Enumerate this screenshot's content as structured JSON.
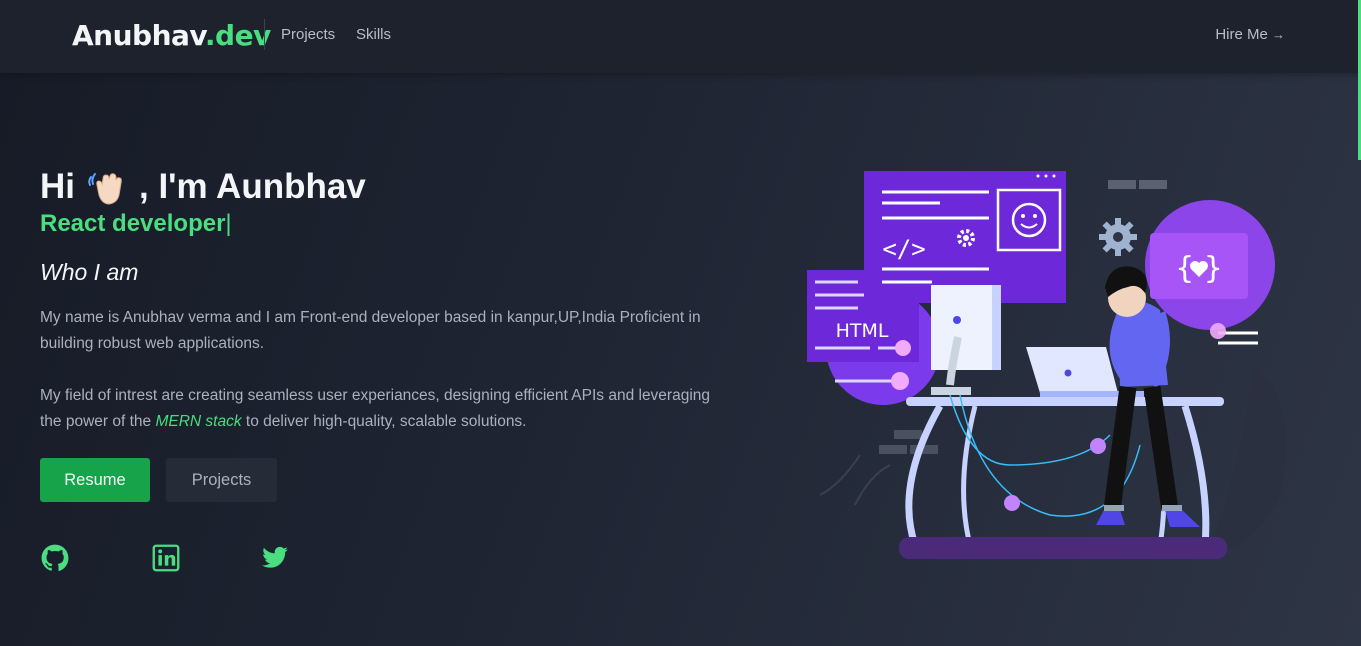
{
  "nav": {
    "brand_name": "Anubhav",
    "brand_suffix": ".dev",
    "links": [
      "Projects",
      "Skills"
    ],
    "hire_label": "Hire Me",
    "hire_icon": "arrow-right-icon"
  },
  "hero": {
    "greeting_prefix": "Hi",
    "greeting_suffix": ", I'm Aunbhav",
    "wave_icon": "waving-hand-icon",
    "role": "React developer",
    "cursor": "|",
    "who_title": "Who I am",
    "bio_1": "My name is Anubhav verma and I am Front-end developer based in kanpur,UP,India Proficient in building robust web applications.",
    "bio_2_before": "My field of intrest are creating seamless user experiances, designing efficient APIs and leveraging the power of the ",
    "bio_2_highlight": "MERN stack",
    "bio_2_after": " to deliver high-quality, scalable solutions.",
    "buttons": {
      "resume": "Resume",
      "projects": "Projects"
    },
    "socials": [
      "github-icon",
      "linkedin-icon",
      "twitter-icon"
    ],
    "illustration": {
      "html_label": "HTML",
      "code_tag": "</>",
      "braces_tag": "{ }"
    }
  },
  "colors": {
    "accent_green": "#4ade80",
    "button_green": "#16a34a",
    "illustration_purple": "#7c3aed",
    "background": "#1f2533"
  }
}
